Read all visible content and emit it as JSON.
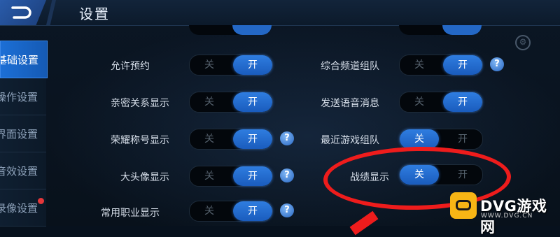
{
  "header": {
    "title": "设置"
  },
  "sidebar": {
    "items": [
      {
        "label": "基础设置",
        "active": true
      },
      {
        "label": "操作设置",
        "active": false
      },
      {
        "label": "界面设置",
        "active": false
      },
      {
        "label": "音效设置",
        "active": false
      },
      {
        "label": "录像设置",
        "active": false,
        "badge": true
      }
    ]
  },
  "settings": {
    "left": [
      {
        "label": "允许预约",
        "off": "关",
        "on": "开",
        "selected": "on",
        "help": false
      },
      {
        "label": "亲密关系显示",
        "off": "关",
        "on": "开",
        "selected": "on",
        "help": false
      },
      {
        "label": "荣耀称号显示",
        "off": "关",
        "on": "开",
        "selected": "on",
        "help": true
      },
      {
        "label": "大头像显示",
        "off": "关",
        "on": "开",
        "selected": "on",
        "help": true
      },
      {
        "label": "常用职业显示",
        "off": "关",
        "on": "开",
        "selected": "on",
        "help": true
      }
    ],
    "right": [
      {
        "label": "综合频道组队",
        "off": "关",
        "on": "开",
        "selected": "on",
        "help": true
      },
      {
        "label": "发送语音消息",
        "off": "关",
        "on": "开",
        "selected": "on",
        "help": false
      },
      {
        "label": "最近游戏组队",
        "off": "关",
        "on": "开",
        "selected": "off",
        "help": false
      },
      {
        "label": "战绩显示",
        "off": "关",
        "on": "开",
        "selected": "off",
        "help": false
      }
    ],
    "help_glyph": "?"
  },
  "watermark": {
    "text": "DVG游戏网",
    "sub": "WWW.DVG.CN"
  },
  "colors": {
    "accent": "#2f7de0",
    "highlight": "#ee1c1c",
    "watermark_bg": "#f7b515"
  }
}
